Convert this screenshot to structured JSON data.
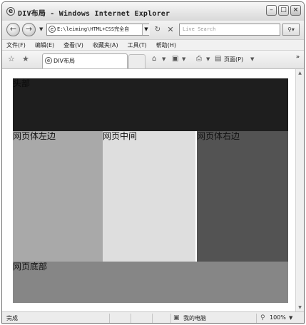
{
  "window": {
    "title": "DIV布局 - Windows Internet Explorer",
    "controls": {
      "minimize": "–",
      "maximize": "□",
      "close": "×"
    }
  },
  "address": {
    "url": "E:\\leiming\\HTML+CSS完全自",
    "search_placeholder": "Live Search"
  },
  "menu": [
    "文件(F)",
    "编辑(E)",
    "查看(V)",
    "收藏夹(A)",
    "工具(T)",
    "帮助(H)"
  ],
  "tab": {
    "label": "DIV布局"
  },
  "commands": {
    "page_label": "页面(P)"
  },
  "page": {
    "header": "头部",
    "left": "网页体左边",
    "center": "网页中间",
    "right": "网页体右边",
    "footer": "网页底部"
  },
  "status": {
    "text": "完成",
    "zone": "我的电脑",
    "zoom": "100%"
  },
  "colors": {
    "header_bg": "#1e1e1e",
    "left_bg": "#a9a9a9",
    "center_bg": "#dedede",
    "right_bg": "#535353",
    "footer_bg": "#868686"
  },
  "icons": {
    "back": "arrow-left-icon",
    "forward": "arrow-right-icon",
    "refresh": "refresh-icon",
    "stop": "stop-icon",
    "search": "search-icon",
    "favorites": "star-icon",
    "add_favorite": "add-favorite-icon",
    "home": "home-icon",
    "feeds": "feeds-icon",
    "print": "print-icon",
    "zone": "computer-icon",
    "zoom": "zoom-icon"
  }
}
